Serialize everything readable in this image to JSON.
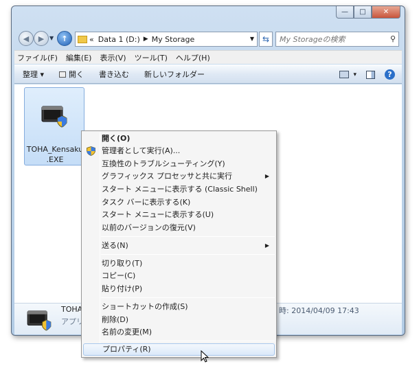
{
  "window": {
    "minimize_glyph": "—",
    "maximize_glyph": "□",
    "close_glyph": "✕"
  },
  "nav": {
    "back_glyph": "◀",
    "forward_glyph": "▶",
    "up_glyph": "↑",
    "breadcrumb_prefix": "«",
    "path": [
      "Data 1 (D:)",
      "My Storage"
    ],
    "search_placeholder": "My Storageの検索"
  },
  "menubar": [
    "ファイル(F)",
    "編集(E)",
    "表示(V)",
    "ツール(T)",
    "ヘルプ(H)"
  ],
  "toolbar": {
    "organize": "整理 ▾",
    "open": "開く",
    "burn": "書き込む",
    "new_folder": "新しいフォルダー",
    "views_dropdown": "▾",
    "help": "?"
  },
  "file": {
    "name_line1": "TOHA_Kensaku",
    "name_line2": ".EXE"
  },
  "details": {
    "name": "TOHA",
    "type": "アプリ",
    "date": "時: 2014/04/09 17:43"
  },
  "context_menu": [
    {
      "label": "開く(O)",
      "bold": true
    },
    {
      "label": "管理者として実行(A)...",
      "icon": "uac-shield-icon"
    },
    {
      "label": "互換性のトラブルシューティング(Y)"
    },
    {
      "label": "グラフィックス プロセッサと共に実行",
      "submenu": true
    },
    {
      "label": "スタート メニューに表示する (Classic Shell)"
    },
    {
      "label": "タスク バーに表示する(K)"
    },
    {
      "label": "スタート メニューに表示する(U)"
    },
    {
      "label": "以前のバージョンの復元(V)"
    },
    {
      "label": "送る(N)",
      "submenu": true
    },
    {
      "label": "切り取り(T)"
    },
    {
      "label": "コピー(C)"
    },
    {
      "label": "貼り付け(P)"
    },
    {
      "label": "ショートカットの作成(S)"
    },
    {
      "label": "削除(D)"
    },
    {
      "label": "名前の変更(M)"
    },
    {
      "label": "プロパティ(R)",
      "highlighted": true
    }
  ],
  "colors": {
    "accent": "#2a6fc9",
    "selection": "#c5ddf7",
    "menu_bg": "#f5f5f5"
  }
}
